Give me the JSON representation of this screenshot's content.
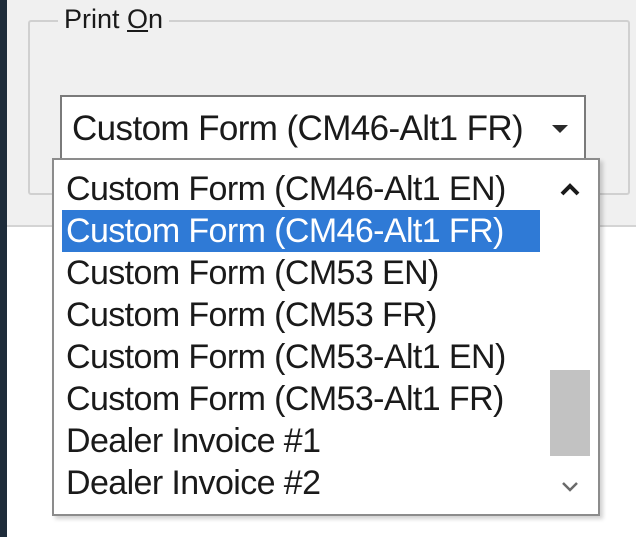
{
  "group": {
    "title_prefix": "Print ",
    "title_mnemonic": "O",
    "title_suffix": "n"
  },
  "combo": {
    "selected_value": "Custom Form (CM46-Alt1 FR)"
  },
  "dropdown": {
    "items": [
      "Custom Form (CM46-Alt1 EN)",
      "Custom Form (CM46-Alt1 FR)",
      "Custom Form (CM53 EN)",
      "Custom Form (CM53 FR)",
      "Custom Form (CM53-Alt1 EN)",
      "Custom Form (CM53-Alt1 FR)",
      "Dealer Invoice #1",
      "Dealer Invoice #2"
    ],
    "selected_index": 1
  },
  "icons": {
    "combo_arrow": "chevron-down-icon",
    "scroll_up": "chevron-up-icon",
    "scroll_down": "chevron-down-icon"
  },
  "colors": {
    "selection": "#2f7ad6",
    "dialog_background": "#f0f0f0",
    "scroll_thumb": "#c2c2c2"
  }
}
